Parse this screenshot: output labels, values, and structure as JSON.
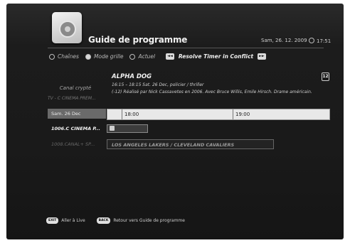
{
  "header": {
    "title": "Guide de programme",
    "date": "Sam, 26. 12. 2009",
    "time": "17:51"
  },
  "modes": [
    {
      "label": "Chaînes",
      "selected": false
    },
    {
      "label": "Mode grille",
      "selected": true
    },
    {
      "label": "Actuel",
      "selected": false
    }
  ],
  "resolve_timer": "Resolve Timer in Conflict",
  "program": {
    "channel_name": "Canal crypté",
    "channel_sub": "TV - C CINEMA PREM...",
    "title": "ALPHA DOG",
    "line1": "16:15 – 18:15 Sat. 26 Dec, policier / thriller",
    "line2": "(-12) Réalisé par Nick Cassavetes en 2006. Avec Bruce Willis, Emile Hirsch. Drame américain.",
    "rating": "12"
  },
  "grid": {
    "date_label": "Sam. 26 Dec",
    "times": [
      "18:00",
      "19:00"
    ],
    "channels": [
      {
        "label": "1006.C CINEMA P..."
      },
      {
        "label": "1008.CANAL+ SP..."
      }
    ],
    "dim_program": "LOS ANGELES LAKERS / CLEVELAND CAVALIERS"
  },
  "footer": {
    "exit_key": "EXIT",
    "exit_label": "Aller à Live",
    "back_key": "BACK",
    "back_label": "Retour vers Guide de programme"
  }
}
